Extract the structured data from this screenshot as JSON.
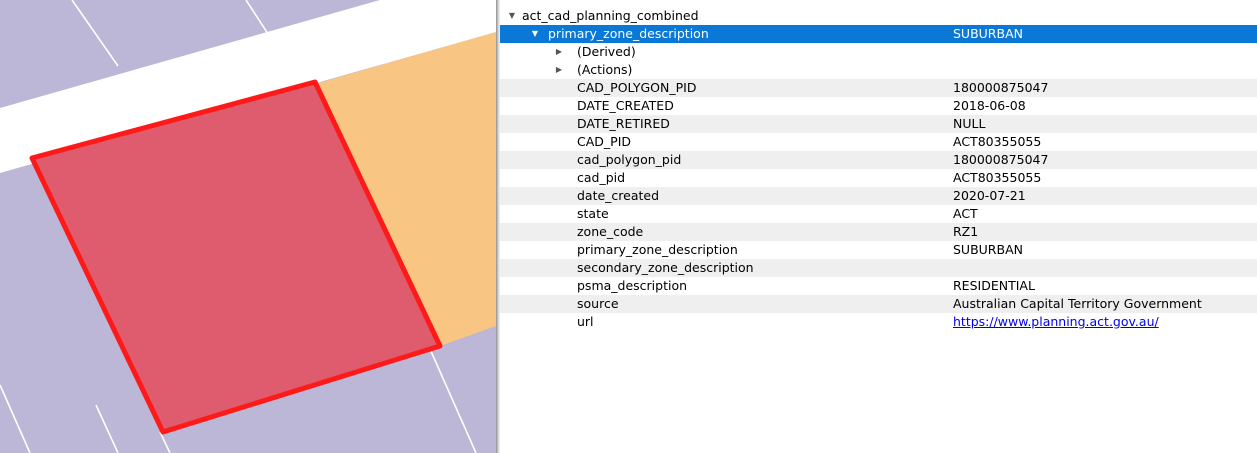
{
  "map": {
    "colors": {
      "parcel_fill": "#bcb6d7",
      "road": "#ffffff",
      "zone_fill": "#f9c582",
      "selection_fill": "#df5c6e",
      "selection_stroke": "#ff1a1a"
    }
  },
  "tree": {
    "layer_name": "act_cad_planning_combined",
    "selected": {
      "label": "primary_zone_description",
      "value": "SUBURBAN"
    },
    "groups": [
      {
        "label": "(Derived)"
      },
      {
        "label": "(Actions)"
      }
    ],
    "attributes": [
      {
        "name": "CAD_POLYGON_PID",
        "value": "180000875047"
      },
      {
        "name": "DATE_CREATED",
        "value": "2018-06-08"
      },
      {
        "name": "DATE_RETIRED",
        "value": "NULL"
      },
      {
        "name": "CAD_PID",
        "value": "ACT80355055"
      },
      {
        "name": "cad_polygon_pid",
        "value": "180000875047"
      },
      {
        "name": "cad_pid",
        "value": "ACT80355055"
      },
      {
        "name": "date_created",
        "value": "2020-07-21"
      },
      {
        "name": "state",
        "value": "ACT"
      },
      {
        "name": "zone_code",
        "value": "RZ1"
      },
      {
        "name": "primary_zone_description",
        "value": "SUBURBAN"
      },
      {
        "name": "secondary_zone_description",
        "value": ""
      },
      {
        "name": "psma_description",
        "value": "RESIDENTIAL"
      },
      {
        "name": "source",
        "value": "Australian Capital Territory Government"
      },
      {
        "name": "url",
        "value": "https://www.planning.act.gov.au/"
      }
    ]
  }
}
